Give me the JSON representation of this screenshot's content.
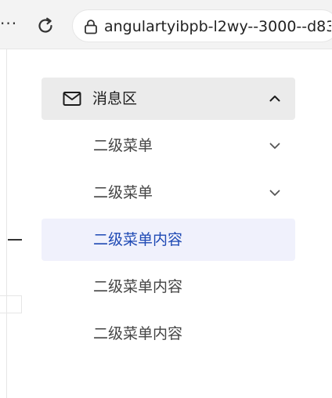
{
  "browser": {
    "url": "angulartyibpb-l2wy--3000--d83",
    "more_label": "···"
  },
  "menu": {
    "title": "消息区",
    "expanded": true,
    "submenus": [
      {
        "label": "二级菜单"
      },
      {
        "label": "二级菜单"
      }
    ],
    "items": [
      {
        "label": "二级菜单内容",
        "active": true
      },
      {
        "label": "二级菜单内容",
        "active": false
      },
      {
        "label": "二级菜单内容",
        "active": false
      }
    ]
  },
  "colors": {
    "active_text": "#1e49b4",
    "active_bg": "#f0f1fc",
    "header_bg": "#ebebeb"
  }
}
